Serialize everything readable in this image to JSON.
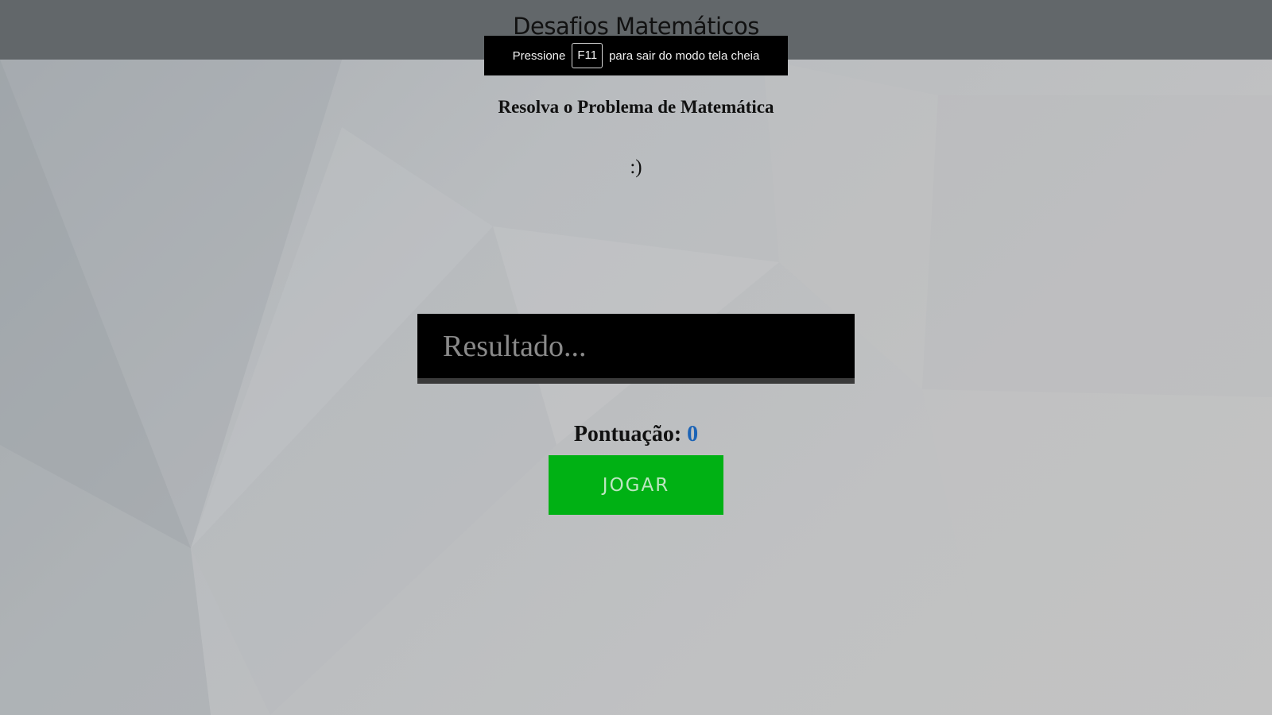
{
  "header": {
    "title": "Desafios Matemáticos"
  },
  "fullscreen_notice": {
    "prefix": "Pressione",
    "key": "F11",
    "suffix": "para sair do modo tela cheia"
  },
  "game": {
    "subtitle": "Resolva o Problema de Matemática",
    "problem": ":)",
    "answer_placeholder": "Resultado...",
    "answer_value": "",
    "score_label": "Pontuação:",
    "score_value": "0",
    "play_label": "JOGAR"
  },
  "colors": {
    "header": "#62676a",
    "play_button": "#00b114",
    "score_value": "#1b63b6",
    "answer_box": "#000000"
  }
}
